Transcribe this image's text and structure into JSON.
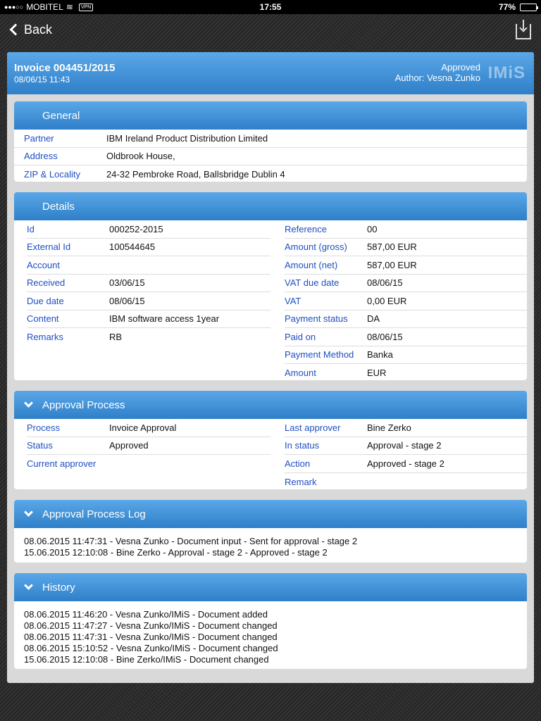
{
  "status_bar": {
    "carrier": "MOBITEL",
    "vpn": "VPN",
    "time": "17:55",
    "battery": "77%",
    "battery_level": 0.77
  },
  "nav": {
    "back_label": "Back"
  },
  "invoice": {
    "title": "Invoice 004451/2015",
    "datetime": "08/06/15 11:43",
    "status": "Approved",
    "author": "Author: Vesna Zunko",
    "logo": "IMiS"
  },
  "general": {
    "title": "General",
    "rows": [
      {
        "label": "Partner",
        "value": "IBM Ireland Product Distribution Limited"
      },
      {
        "label": "Address",
        "value": "Oldbrook House,"
      },
      {
        "label": "ZIP & Locality",
        "value": "24-32 Pembroke Road, Ballsbridge Dublin 4"
      }
    ]
  },
  "details": {
    "title": "Details",
    "left": [
      {
        "label": "Id",
        "value": "000252-2015"
      },
      {
        "label": "External Id",
        "value": "100544645"
      },
      {
        "label": "Account",
        "value": ""
      },
      {
        "label": "Received",
        "value": "03/06/15"
      },
      {
        "label": "Due date",
        "value": "08/06/15"
      },
      {
        "label": "Content",
        "value": "IBM software access 1year"
      },
      {
        "label": "Remarks",
        "value": "RB"
      }
    ],
    "right": [
      {
        "label": "Reference",
        "value": "00"
      },
      {
        "label": "Amount (gross)",
        "value": "587,00 EUR"
      },
      {
        "label": "Amount (net)",
        "value": "587,00 EUR"
      },
      {
        "label": "VAT due date",
        "value": "08/06/15"
      },
      {
        "label": "VAT",
        "value": "0,00 EUR"
      },
      {
        "label": "Payment status",
        "value": "DA"
      },
      {
        "label": "Paid on",
        "value": "08/06/15"
      },
      {
        "label": "Payment Method",
        "value": "Banka"
      },
      {
        "label": "Amount",
        "value": " EUR"
      }
    ]
  },
  "approval": {
    "title": "Approval Process",
    "left": [
      {
        "label": "Process",
        "value": "Invoice Approval"
      },
      {
        "label": "Status",
        "value": "Approved"
      },
      {
        "label": "Current approver",
        "value": ""
      }
    ],
    "right": [
      {
        "label": "Last approver",
        "value": "Bine Zerko"
      },
      {
        "label": "In status",
        "value": "Approval - stage 2"
      },
      {
        "label": "Action",
        "value": "Approved - stage 2"
      },
      {
        "label": "Remark",
        "value": ""
      }
    ]
  },
  "approval_log": {
    "title": "Approval Process Log",
    "entries": [
      "08.06.2015 11:47:31 - Vesna Zunko - Document input - Sent for approval - stage 2",
      "15.06.2015 12:10:08 - Bine Zerko - Approval - stage 2 - Approved - stage 2"
    ]
  },
  "history": {
    "title": "History",
    "entries": [
      "08.06.2015 11:46:20 - Vesna Zunko/IMiS - Document added",
      "08.06.2015 11:47:27 - Vesna Zunko/IMiS - Document changed",
      "08.06.2015 11:47:31 - Vesna Zunko/IMiS - Document changed",
      "08.06.2015 15:10:52 - Vesna Zunko/IMiS - Document changed",
      "15.06.2015 12:10:08 - Bine Zerko/IMiS - Document changed"
    ]
  }
}
